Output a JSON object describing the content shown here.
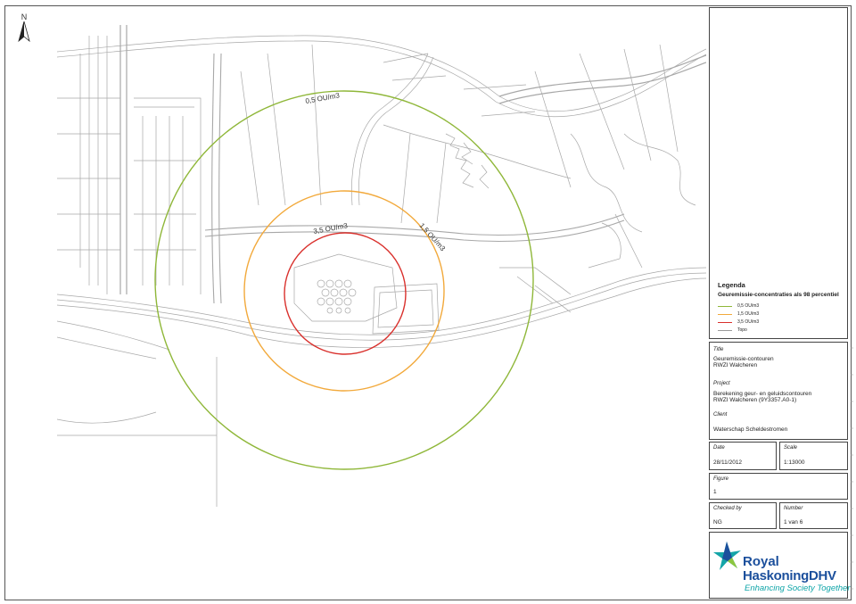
{
  "north_label": "N",
  "contours": [
    {
      "label": "0,5 OU/m3",
      "color": "#8fb739"
    },
    {
      "label": "1,5 OU/m3",
      "color": "#f2a93b"
    },
    {
      "label": "3,5 OU/m3",
      "color": "#d9302c"
    }
  ],
  "legend": {
    "title": "Legenda",
    "subtitle": "Geuremissie-concentraties als 98 percentiel",
    "items": [
      {
        "label": "0,5 OU/m3",
        "color": "#8fb739"
      },
      {
        "label": "1,5 OU/m3",
        "color": "#f2a93b"
      },
      {
        "label": "3,5 OU/m3",
        "color": "#d9302c"
      },
      {
        "label": "Topo",
        "color": "#9a9a9a"
      }
    ]
  },
  "title_block": {
    "title_label": "Title",
    "title_line1": "Geuremissie-contouren",
    "title_line2": "RWZI Walcheren",
    "project_label": "Project",
    "project_line1": "Berekening geur- en geluidscontouren",
    "project_line2": "RWZI Walcheren (9Y3357.A0-1)",
    "client_label": "Client",
    "client_value": "Waterschap Scheldestromen",
    "date_label": "Date",
    "date_value": "28/11/2012",
    "scale_label": "Scale",
    "scale_value": "1:13000",
    "figure_label": "Figure",
    "figure_value": "1",
    "checked_label": "Checked by",
    "checked_value": "NG",
    "number_label": "Number",
    "number_value": "1 van 6"
  },
  "logo": {
    "line1": "Royal",
    "line2": "HaskoningDHV",
    "tagline": "Enhancing Society Together"
  }
}
